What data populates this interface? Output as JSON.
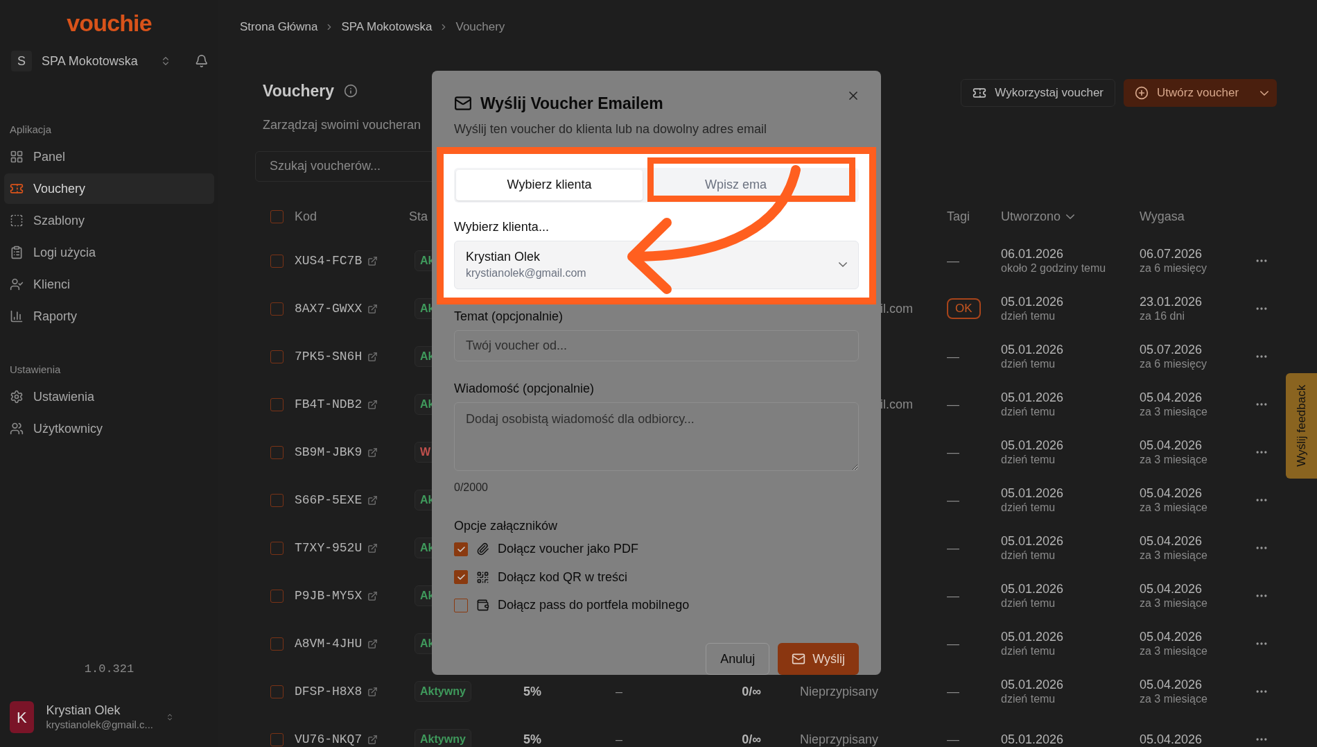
{
  "sidebar": {
    "logo": "vouchie",
    "org": {
      "initial": "S",
      "name": "SPA Mokotowska"
    },
    "sections": [
      {
        "title": "Aplikacja",
        "items": [
          {
            "label": "Panel",
            "selected": false
          },
          {
            "label": "Vouchery",
            "selected": true
          },
          {
            "label": "Szablony",
            "selected": false
          },
          {
            "label": "Logi użycia",
            "selected": false
          },
          {
            "label": "Klienci",
            "selected": false
          },
          {
            "label": "Raporty",
            "selected": false
          }
        ]
      },
      {
        "title": "Ustawienia",
        "items": [
          {
            "label": "Ustawienia",
            "selected": false
          },
          {
            "label": "Użytkownicy",
            "selected": false
          }
        ]
      }
    ],
    "version": "1.0.321",
    "user": {
      "initial": "K",
      "name": "Krystian Olek",
      "email": "krystianolek@gmail.c..."
    }
  },
  "breadcrumbs": [
    "Strona Główna",
    "SPA Mokotowska",
    "Vouchery"
  ],
  "page": {
    "title": "Vouchery",
    "subtitle": "Zarządzaj swoimi voucheran",
    "search_placeholder": "Szukaj voucherów...",
    "redeem_button": "Wykorzystaj voucher",
    "create_button": "Utwórz voucher"
  },
  "table": {
    "header_checked": false,
    "columns": [
      "Kod",
      "Sta",
      "Tagi",
      "Utworzono",
      "Wygasa"
    ],
    "rows": [
      {
        "checked": false,
        "code": "XUS4-FC7B",
        "status": {
          "label": "Ak",
          "color": "#3f9a5c"
        },
        "tag": {
          "kind": "empty",
          "label": "—"
        },
        "created": "06.01.2026",
        "created_rel": "około 2 godziny temu",
        "expires": "06.07.2026",
        "expires_rel": "za 6 miesięcy"
      },
      {
        "checked": false,
        "code": "8AX7-GWXX",
        "status": {
          "label": "Ak",
          "color": "#3f9a5c"
        },
        "client_tail": "il.com",
        "tag": {
          "kind": "badge",
          "label": "OK"
        },
        "created": "05.01.2026",
        "created_rel": "dzień temu",
        "expires": "23.01.2026",
        "expires_rel": "za 16 dni"
      },
      {
        "checked": false,
        "code": "7PK5-SN6H",
        "status": {
          "label": "Ak",
          "color": "#3f9a5c"
        },
        "tag": {
          "kind": "empty",
          "label": "—"
        },
        "created": "05.01.2026",
        "created_rel": "dzień temu",
        "expires": "05.07.2026",
        "expires_rel": "za 6 miesięcy"
      },
      {
        "checked": false,
        "code": "FB4T-NDB2",
        "status": {
          "label": "Ak",
          "color": "#3f9a5c"
        },
        "client_tail": "il.com",
        "tag": {
          "kind": "empty",
          "label": "—"
        },
        "created": "05.01.2026",
        "created_rel": "dzień temu",
        "expires": "05.04.2026",
        "expires_rel": "za 3 miesiące"
      },
      {
        "checked": false,
        "code": "SB9M-JBK9",
        "status": {
          "label": "W",
          "color": "#c0504d"
        },
        "tag": {
          "kind": "empty",
          "label": "—"
        },
        "created": "05.01.2026",
        "created_rel": "dzień temu",
        "expires": "05.04.2026",
        "expires_rel": "za 3 miesiące"
      },
      {
        "checked": false,
        "code": "S66P-5EXE",
        "status": {
          "label": "Ak",
          "color": "#3f9a5c"
        },
        "tag": {
          "kind": "empty",
          "label": "—"
        },
        "created": "05.01.2026",
        "created_rel": "dzień temu",
        "expires": "05.04.2026",
        "expires_rel": "za 3 miesiące"
      },
      {
        "checked": false,
        "code": "T7XY-952U",
        "status": {
          "label": "Ak",
          "color": "#3f9a5c"
        },
        "tag": {
          "kind": "empty",
          "label": "—"
        },
        "created": "05.01.2026",
        "created_rel": "dzień temu",
        "expires": "05.04.2026",
        "expires_rel": "za 3 miesiące"
      },
      {
        "checked": false,
        "code": "P9JB-MY5X",
        "status": {
          "label": "Ak",
          "color": "#3f9a5c"
        },
        "tag": {
          "kind": "empty",
          "label": "—"
        },
        "created": "05.01.2026",
        "created_rel": "dzień temu",
        "expires": "05.04.2026",
        "expires_rel": "za 3 miesiące"
      },
      {
        "checked": false,
        "code": "A8VM-4JHU",
        "status": {
          "label": "Ak",
          "color": "#3f9a5c"
        },
        "tag": {
          "kind": "empty",
          "label": "—"
        },
        "created": "05.01.2026",
        "created_rel": "dzień temu",
        "expires": "05.04.2026",
        "expires_rel": "za 3 miesiące"
      },
      {
        "checked": false,
        "code": "DFSP-H8X8",
        "status": {
          "label": "Aktywny",
          "color": "#3f9a5c"
        },
        "discount": "5%",
        "column_5": "–",
        "usage": "0/∞",
        "client": "Nieprzypisany",
        "tag": {
          "kind": "empty",
          "label": "—"
        },
        "created": "05.01.2026",
        "created_rel": "dzień temu",
        "expires": "05.04.2026",
        "expires_rel": "za 3 miesiące"
      },
      {
        "checked": false,
        "code": "VU76-NKQ7",
        "status": {
          "label": "Aktywny",
          "color": "#3f9a5c"
        },
        "discount": "5%",
        "column_5": "–",
        "usage": "0/∞",
        "client": "Nieprzypisany",
        "tag": {
          "kind": "empty",
          "label": "—"
        },
        "created": "05.01.2026",
        "expires": "05.04.2026"
      }
    ]
  },
  "dialog": {
    "title": "Wyślij Voucher Emailem",
    "subtitle": "Wyślij ten voucher do klienta lub na dowolny adres email",
    "tabs": [
      {
        "label": "Wybierz klienta",
        "selected": true
      },
      {
        "label": "Wpisz ema",
        "selected": false
      }
    ],
    "client_label": "Wybierz klienta...",
    "client": {
      "name": "Krystian Olek",
      "email": "krystianolek@gmail.com"
    },
    "subject": {
      "label": "Temat (opcjonalnie)",
      "placeholder": "Twój voucher od..."
    },
    "message": {
      "label": "Wiadomość (opcjonalnie)",
      "placeholder": "Dodaj osobistą wiadomość dla odbiorcy...",
      "counter": "0/2000"
    },
    "attachments": {
      "title": "Opcje załączników",
      "options": [
        {
          "label": "Dołącz voucher jako PDF",
          "checked": true
        },
        {
          "label": "Dołącz kod QR w treści",
          "checked": true
        },
        {
          "label": "Dołącz pass do portfela mobilnego",
          "checked": false
        }
      ]
    },
    "cancel_button": "Anuluj",
    "send_button": "Wyślij"
  },
  "feedback_tab": "Wyślij feedback"
}
